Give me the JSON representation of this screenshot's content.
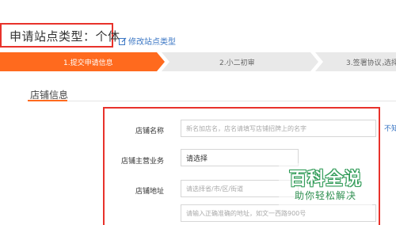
{
  "header": {
    "title": "申请站点类型：个体",
    "edit_link": "修改站点类型"
  },
  "steps": [
    {
      "label": "1.提交申请信息",
      "state": "active"
    },
    {
      "label": "2.小二初审",
      "state": "pending"
    },
    {
      "label": "3.签署协议，",
      "state": "pending"
    },
    {
      "label": "选择",
      "state": "pending"
    }
  ],
  "section": {
    "title": "店铺信息"
  },
  "form": {
    "store_name": {
      "label": "店铺名称",
      "placeholder": "新名加店名，店名请填写店铺招牌上的名字"
    },
    "store_business": {
      "label": "店铺主营业务",
      "value": "请选择"
    },
    "store_address": {
      "label": "店铺地址",
      "region_placeholder": "请选择省/市/区/街道",
      "detail_placeholder": "请输入正确准确的地址，如文一西路900号"
    },
    "side_link": "不知"
  },
  "watermark": {
    "main": "百科全说",
    "sub": "助你轻松解决"
  },
  "colors": {
    "accent_orange": "#ff6a1e",
    "highlight_red": "#e8322b",
    "link_blue": "#3a76c4",
    "step_inactive": "#e9e9e9"
  }
}
